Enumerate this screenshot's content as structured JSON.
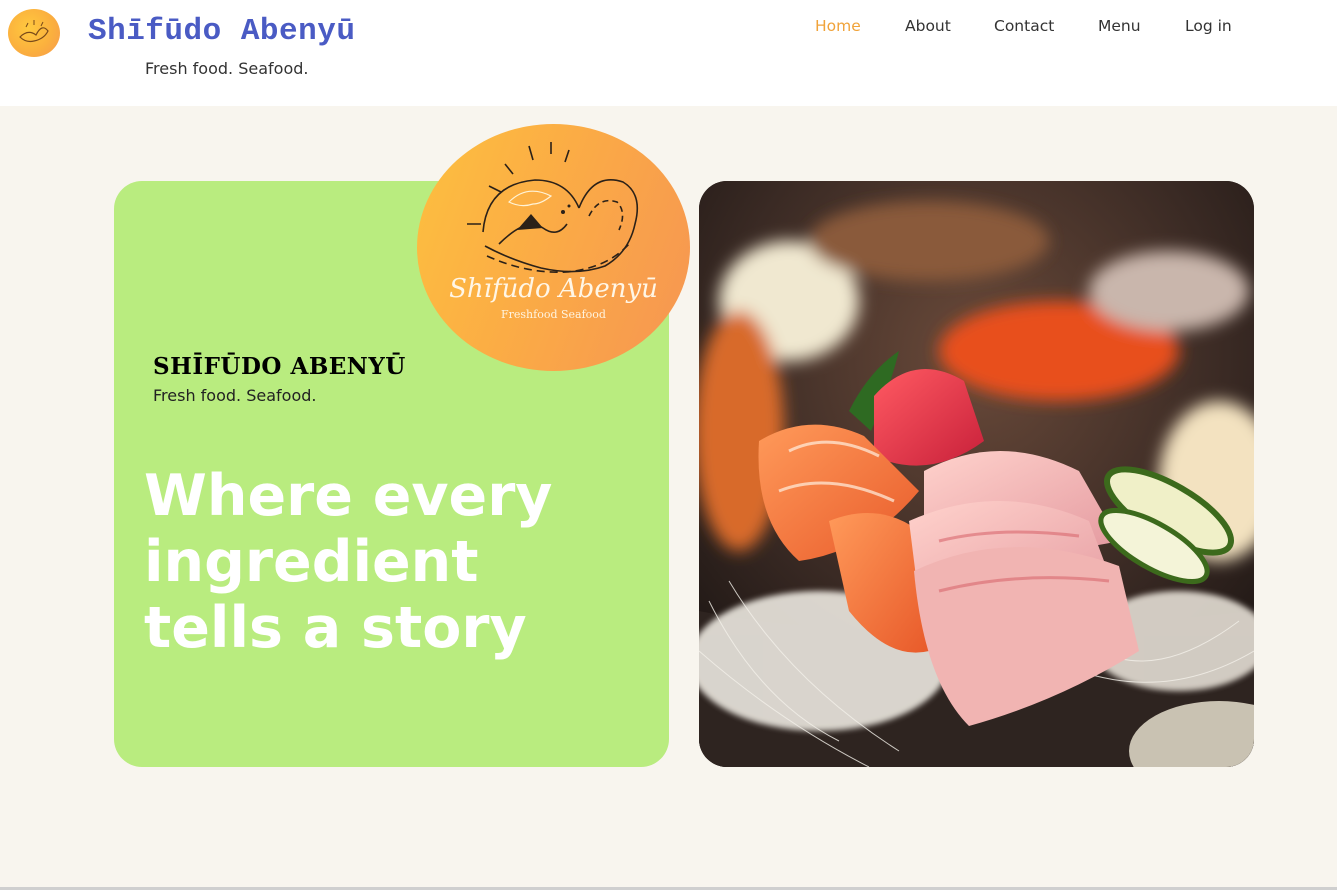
{
  "header": {
    "site_title": "Shīfūdo Abenyū",
    "tagline": "Fresh food. Seafood.",
    "logo_icon": "wave-sun-logo-icon"
  },
  "nav": {
    "items": [
      {
        "label": "Home",
        "active": true
      },
      {
        "label": "About",
        "active": false
      },
      {
        "label": "Contact",
        "active": false
      },
      {
        "label": "Menu",
        "active": false
      },
      {
        "label": "Log in",
        "active": false
      }
    ]
  },
  "hero": {
    "brand_name": "SHĪFŪDO ABENYŪ",
    "brand_tagline": "Fresh food. Seafood.",
    "headline": "Where every ingredient tells a story",
    "logo_badge": {
      "title": "Shīfūdo Abenyū",
      "subtitle": "Freshfood Seafood"
    },
    "photo_icon": "sashimi-platter-photo"
  },
  "colors": {
    "accent": "#f0a33a",
    "title_blue": "#4a5bc4",
    "hero_green": "#b9ec7f",
    "background": "#f8f5ee"
  }
}
